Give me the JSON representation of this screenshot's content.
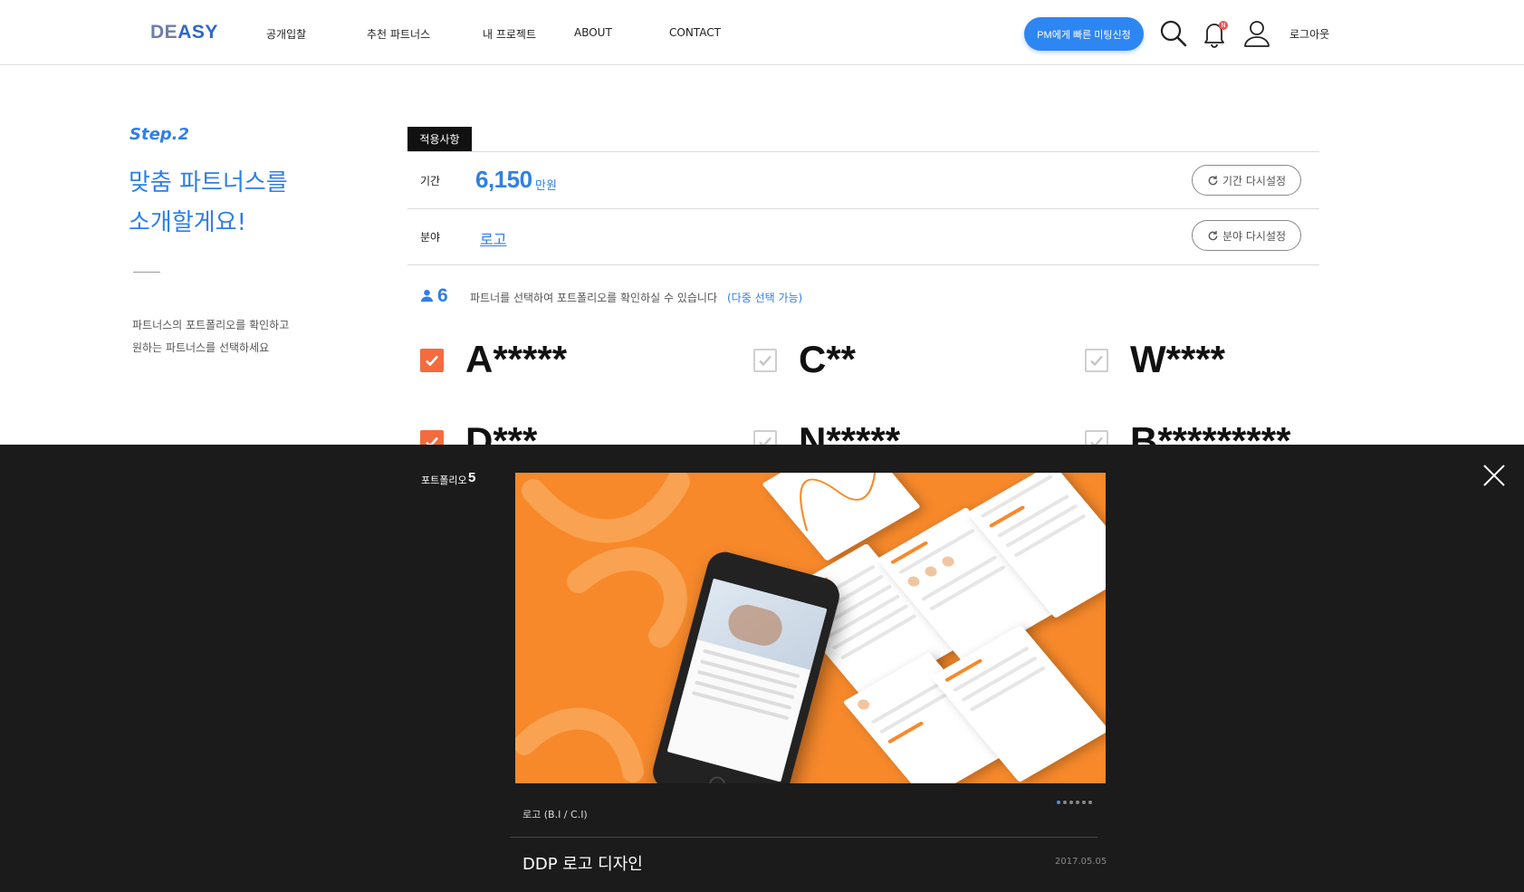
{
  "header": {
    "logo_a": "DE",
    "logo_b": "ASY",
    "nav": [
      "공개입찰",
      "추천 파트너스",
      "내 프로젝트",
      "ABOUT",
      "CONTACT"
    ],
    "cta_label": "PM에게 빠른 미팅신청",
    "notif_count": "N",
    "logout_label": "로그아웃",
    "brand_color": "#2e86f3"
  },
  "left": {
    "step": "Step.2",
    "headline_1": "맞춤 파트너스를",
    "headline_2": "소개할게요!",
    "desc_1": "파트너스의 포트폴리오를 확인하고",
    "desc_2": "원하는 파트너스를 선택하세요"
  },
  "applied": {
    "tag": "적용사항",
    "period_label": "기간",
    "period_value": "6,150",
    "period_unit": "만원",
    "period_reset": "기간 다시설정",
    "field_label": "분야",
    "field_value": "로고",
    "field_reset": "분야 다시설정"
  },
  "partners": {
    "count": "6",
    "text": "파트너를 선택하여 포트폴리오를 확인하실 수 있습니다",
    "multi": "(다중 선택 가능)",
    "items": [
      {
        "name": "A*****",
        "checked": true
      },
      {
        "name": "C**",
        "checked": false
      },
      {
        "name": "W****",
        "checked": false
      },
      {
        "name": "D***",
        "checked": true
      },
      {
        "name": "N*****",
        "checked": false
      },
      {
        "name": "B*********",
        "checked": false
      }
    ]
  },
  "portfolio": {
    "label": "포트폴리오",
    "count": "5",
    "category": "로고 (B.I / C.I)",
    "title": "DDP 로고 디자인",
    "date": "2017.05.05",
    "pages": 6,
    "active_page": 1,
    "accent": "#f7892b"
  }
}
